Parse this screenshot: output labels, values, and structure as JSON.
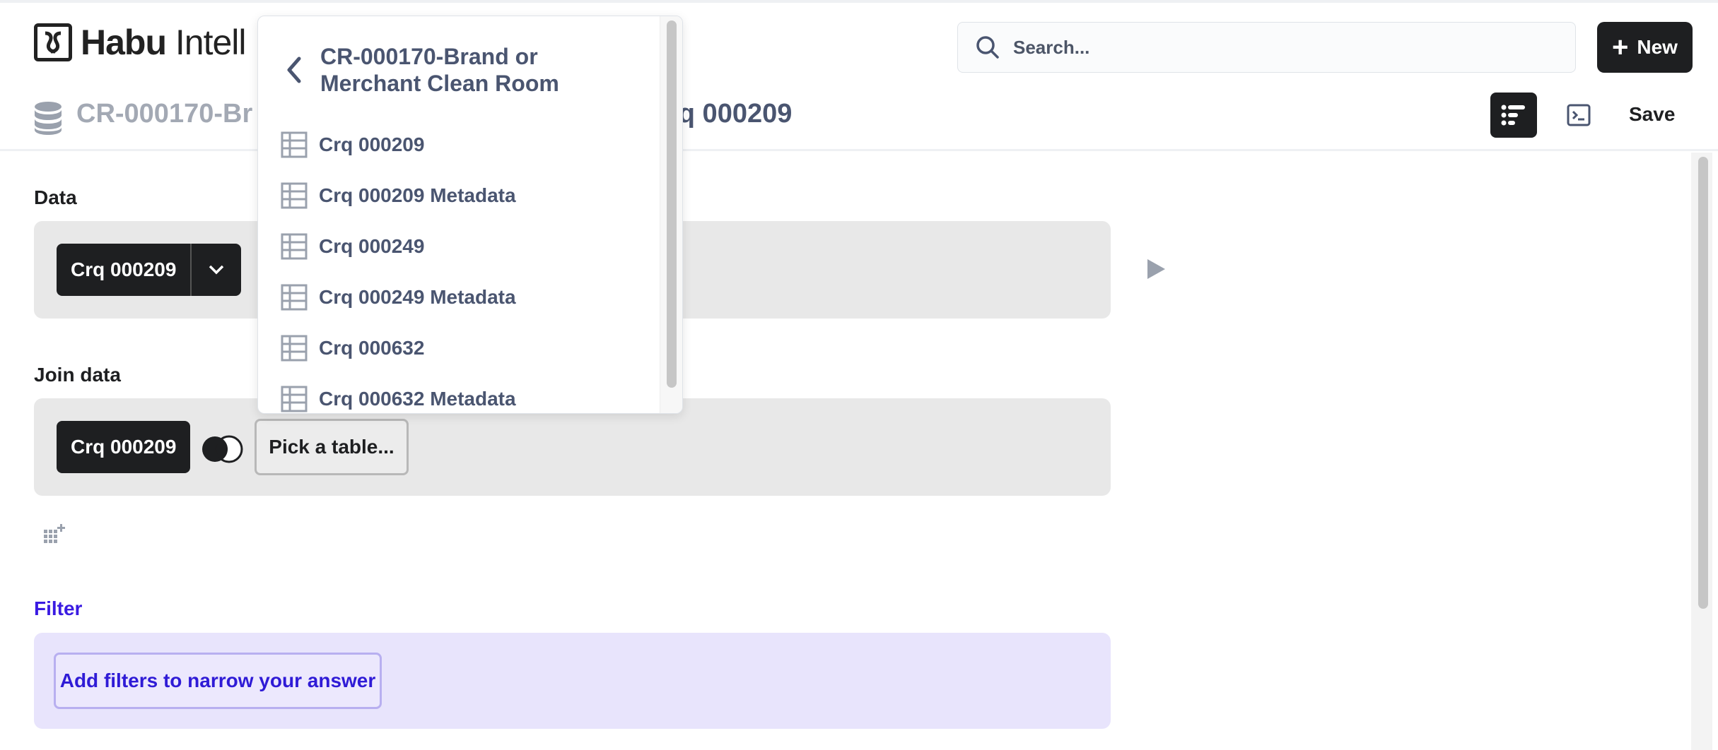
{
  "header": {
    "logo_bold": "Habu",
    "logo_light": " Intell",
    "search_placeholder": "Search...",
    "new_label": "New"
  },
  "subbar": {
    "crumb_left": "CR-000170-Br",
    "crumb_right": "rq 000209",
    "save_label": "Save"
  },
  "data_section": {
    "label": "Data",
    "chip_label": "Crq 000209"
  },
  "join_section": {
    "label": "Join data",
    "chip_label": "Crq 000209",
    "pick_label": "Pick a table..."
  },
  "filter_section": {
    "label": "Filter",
    "button_label": "Add filters to narrow your answer"
  },
  "dropdown": {
    "title": "CR-000170-Brand or Merchant Clean Room",
    "items": [
      {
        "label": "Crq 000209",
        "icon": "table-icon"
      },
      {
        "label": "Crq 000209 Metadata",
        "icon": "table-icon"
      },
      {
        "label": "Crq 000249",
        "icon": "table-icon"
      },
      {
        "label": "Crq 000249 Metadata",
        "icon": "table-icon"
      },
      {
        "label": "Crq 000632",
        "icon": "table-icon"
      },
      {
        "label": "Crq 000632 Metadata",
        "icon": "table-icon"
      }
    ]
  },
  "colors": {
    "filter_accent": "#3a1be2",
    "dark": "#1e1f21",
    "panel_bg": "#e8e8e8",
    "filter_bg": "#e8e4fc"
  }
}
